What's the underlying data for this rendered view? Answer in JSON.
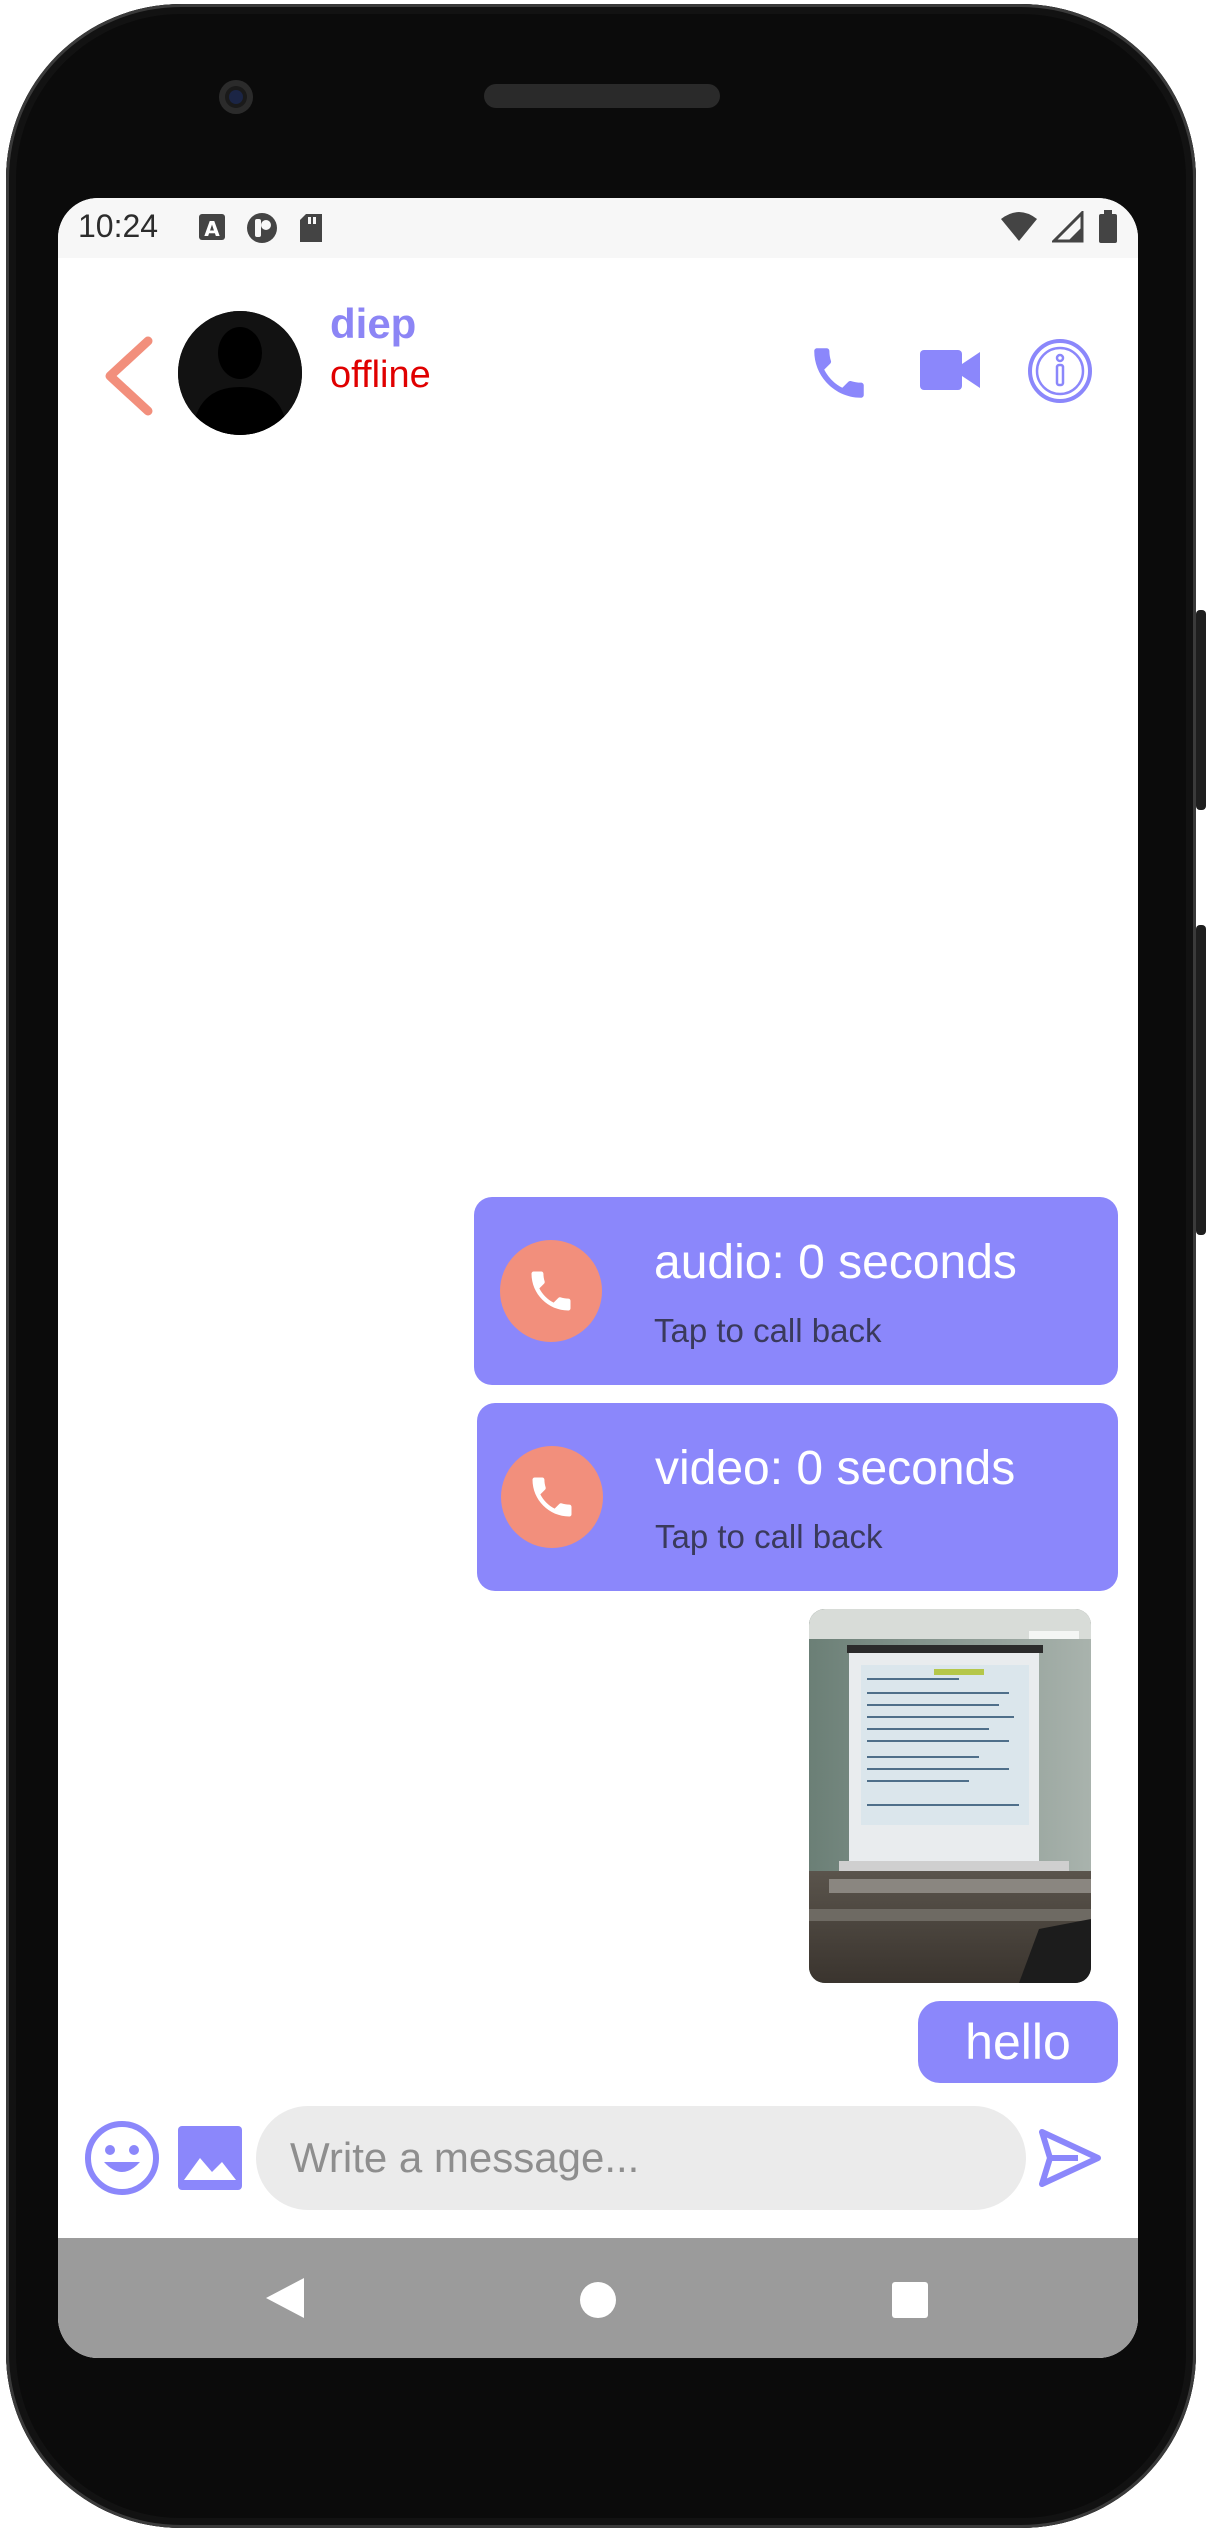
{
  "status_bar": {
    "time": "10:24",
    "left_icons": [
      "a-letter-icon",
      "p-circle-icon",
      "sd-card-icon"
    ],
    "right_icons": [
      "wifi-icon",
      "signal-icon",
      "battery-icon"
    ]
  },
  "header": {
    "contact_name": "diep",
    "contact_status": "offline",
    "icons": [
      "back-arrow-icon",
      "phone-icon",
      "video-camera-icon",
      "info-icon"
    ]
  },
  "messages": [
    {
      "type": "call",
      "title": "audio: 0 seconds",
      "subtitle": "Tap to call back"
    },
    {
      "type": "call",
      "title": "video: 0 seconds",
      "subtitle": "Tap to call back"
    },
    {
      "type": "image"
    },
    {
      "type": "text",
      "text": "hello"
    }
  ],
  "input_bar": {
    "placeholder": "Write a message...",
    "icons": [
      "emoji-icon",
      "gallery-icon",
      "send-icon"
    ]
  },
  "nav_bar": {
    "icons": [
      "back-triangle-icon",
      "home-circle-icon",
      "recents-square-icon"
    ]
  },
  "colors": {
    "accent": "#8b87fb",
    "call_circle": "#f28f7c",
    "back_arrow": "#f28f7c",
    "offline": "#e00000",
    "nav_bar": "#9b9b9b"
  }
}
